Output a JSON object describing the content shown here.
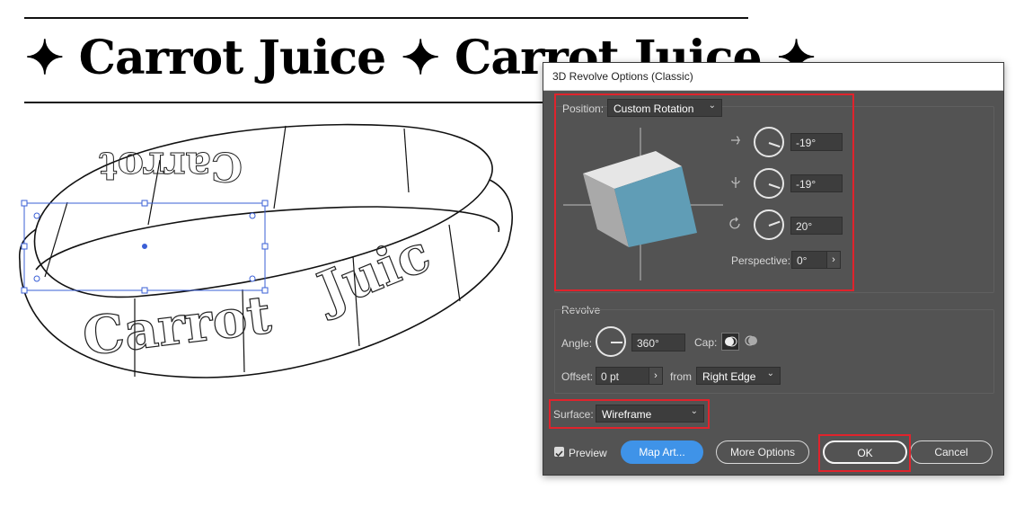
{
  "artboard": {
    "banner_text": "✦ Carrot Juice ✦ Carrot Juice ✦",
    "ring_label": "Carrot Juice"
  },
  "dialog": {
    "title": "3D Revolve Options (Classic)",
    "position": {
      "label": "Position:",
      "value": "Custom Rotation",
      "x_rotation": "-19°",
      "y_rotation": "-19°",
      "z_rotation": "20°",
      "perspective_label": "Perspective:",
      "perspective_value": "0°"
    },
    "revolve": {
      "section_label": "Revolve",
      "angle_label": "Angle:",
      "angle_value": "360°",
      "cap_label": "Cap:",
      "offset_label": "Offset:",
      "offset_value": "0 pt",
      "from_label": "from",
      "from_value": "Right Edge"
    },
    "surface": {
      "label": "Surface:",
      "value": "Wireframe"
    },
    "footer": {
      "preview_label": "Preview",
      "preview_checked": true,
      "map_art_label": "Map Art...",
      "more_options_label": "More Options",
      "ok_label": "OK",
      "cancel_label": "Cancel"
    }
  },
  "colors": {
    "dialog_bg": "#535353",
    "cube_front": "#609db6",
    "highlight": "#e0232c",
    "primary_button": "#3f93e8",
    "selection": "#3a5fd6"
  }
}
